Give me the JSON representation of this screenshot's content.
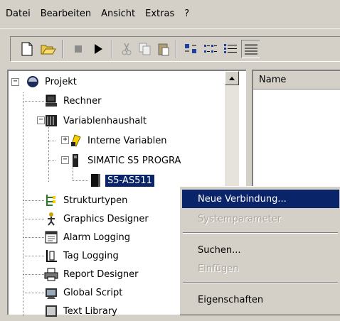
{
  "menubar": {
    "items": [
      {
        "label": "Datei"
      },
      {
        "label": "Bearbeiten"
      },
      {
        "label": "Ansicht"
      },
      {
        "label": "Extras"
      },
      {
        "label": "?"
      }
    ]
  },
  "toolbar": {
    "buttons": [
      "new-icon",
      "open-icon",
      "stop-icon",
      "play-icon",
      "cut-icon",
      "copy-icon",
      "paste-icon",
      "large-icons-icon",
      "small-icons-icon",
      "list-icon",
      "details-icon"
    ]
  },
  "tree": {
    "root": "Projekt",
    "items": {
      "rechner": "Rechner",
      "variablenhaushalt": "Variablenhaushalt",
      "interne_variablen": "Interne Variablen",
      "simatic": "SIMATIC S5 PROGRA",
      "s5": "S5-AS511",
      "strukturtypen": "Strukturtypen",
      "graphics": "Graphics Designer",
      "alarm": "Alarm Logging",
      "tag": "Tag Logging",
      "report": "Report Designer",
      "global": "Global Script",
      "text": "Text Library"
    }
  },
  "list": {
    "header_name": "Name"
  },
  "context_menu": {
    "neue_verbindung": "Neue Verbindung...",
    "systemparameter": "Systemparameter",
    "suchen": "Suchen...",
    "einfuegen": "Einfügen",
    "eigenschaften": "Eigenschaften"
  },
  "colors": {
    "selection": "#0a246a",
    "face": "#d4d0c8"
  }
}
